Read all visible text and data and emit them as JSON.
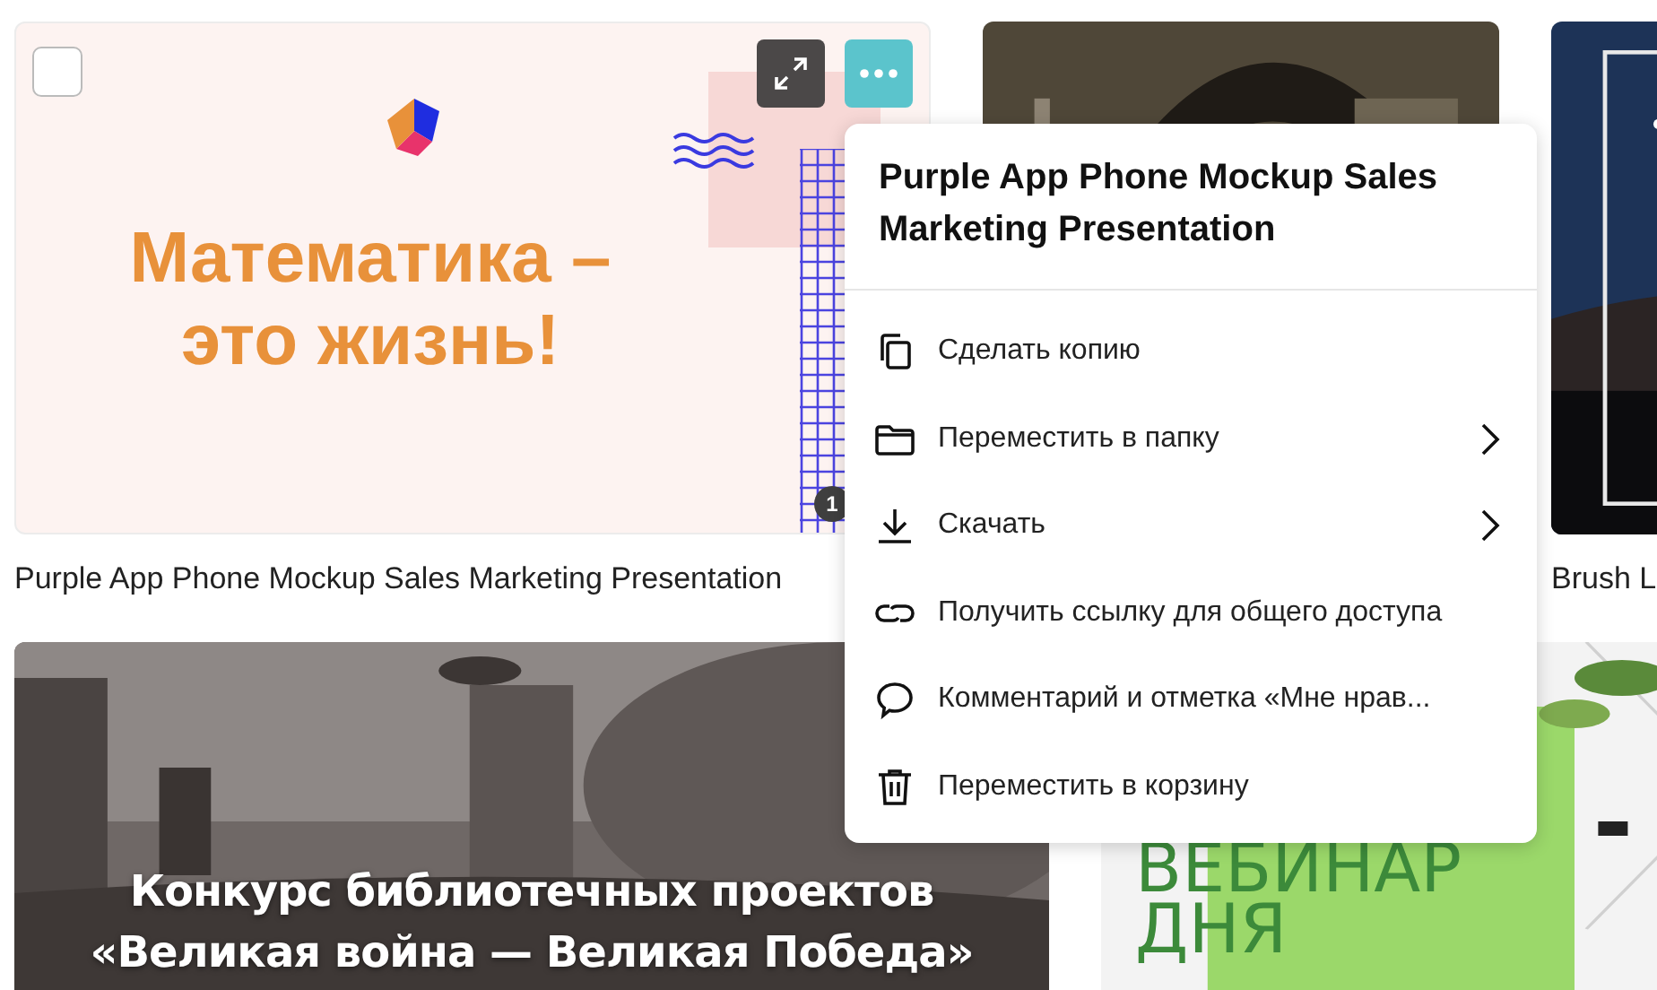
{
  "design_rows": [
    {
      "designs": [
        {
          "kind": "math-slide",
          "heading": [
            "Математика –",
            "это жизнь!"
          ],
          "checked": false,
          "page_badge": "1",
          "caption": "Purple App Phone Mockup Sales Marketing Presentation"
        },
        {
          "kind": "portrait-photo"
        },
        {
          "kind": "night-sky-photo",
          "caption": "Brush L"
        }
      ]
    },
    {
      "designs": [
        {
          "kind": "war-photo-poster",
          "heading": [
            "Конкурс библиотечных проектов",
            "«Великая война — Великая Победа»"
          ]
        },
        {
          "kind": "webinar-poster",
          "heading": [
            "ВЕБИНАР",
            "ДНЯ"
          ]
        }
      ]
    }
  ],
  "context_menu": {
    "title": "Purple App Phone Mockup Sales Marketing Presentation",
    "items": [
      {
        "kind": "copy",
        "label": "Сделать копию",
        "submenu": false
      },
      {
        "kind": "folder",
        "label": "Переместить в папку",
        "submenu": true
      },
      {
        "kind": "download",
        "label": "Скачать",
        "submenu": true
      },
      {
        "kind": "link",
        "label": "Получить ссылку для общего доступа",
        "submenu": false
      },
      {
        "kind": "comment",
        "label": "Комментарий и отметка «Мне нрав...",
        "submenu": false
      },
      {
        "kind": "trash",
        "label": "Переместить в корзину",
        "submenu": false
      }
    ]
  }
}
